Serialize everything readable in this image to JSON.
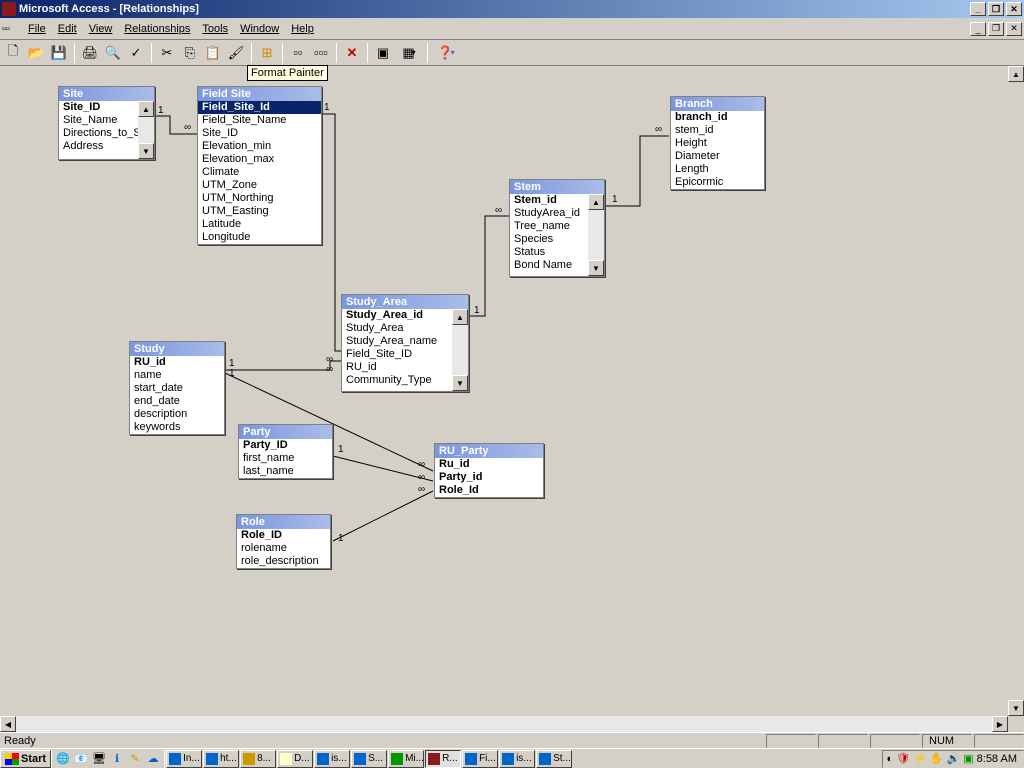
{
  "titlebar": {
    "title": "Microsoft Access - [Relationships]"
  },
  "menubar": {
    "file": "File",
    "edit": "Edit",
    "view": "View",
    "relationships": "Relationships",
    "tools": "Tools",
    "window": "Window",
    "help": "Help"
  },
  "tooltip": "Format Painter",
  "tables": {
    "site": {
      "title": "Site",
      "fields": [
        "Site_ID",
        "Site_Name",
        "Directions_to_Si",
        "Address"
      ]
    },
    "field_site": {
      "title": "Field Site",
      "fields": [
        "Field_Site_Id",
        "Field_Site_Name",
        "Site_ID",
        "Elevation_min",
        "Elevation_max",
        "Climate",
        "UTM_Zone",
        "UTM_Northing",
        "UTM_Easting",
        "Latitude",
        "Longitude"
      ]
    },
    "study_area": {
      "title": "Study_Area",
      "fields": [
        "Study_Area_id",
        "Study_Area",
        "Study_Area_name",
        "Field_Site_ID",
        "RU_id",
        "Community_Type"
      ]
    },
    "stem": {
      "title": "Stem",
      "fields": [
        "Stem_id",
        "StudyArea_id",
        "Tree_name",
        "Species",
        "Status",
        "Bond Name"
      ]
    },
    "branch": {
      "title": "Branch",
      "fields": [
        "branch_id",
        "stem_id",
        "Height",
        "Diameter",
        "Length",
        "Epicormic"
      ]
    },
    "study": {
      "title": "Study",
      "fields": [
        "RU_id",
        "name",
        "start_date",
        "end_date",
        "description",
        "keywords"
      ]
    },
    "party": {
      "title": "Party",
      "fields": [
        "Party_ID",
        "first_name",
        "last_name"
      ]
    },
    "role": {
      "title": "Role",
      "fields": [
        "Role_ID",
        "rolename",
        "role_description"
      ]
    },
    "ru_party": {
      "title": "RU_Party",
      "fields": [
        "Ru_id",
        "Party_id",
        "Role_Id"
      ]
    }
  },
  "cardinality": {
    "one": "1",
    "many": "∞"
  },
  "statusbar": {
    "ready": "Ready",
    "num": "NUM"
  },
  "taskbar": {
    "start": "Start",
    "tasks": [
      "In...",
      "ht...",
      "8...",
      "D...",
      "is...",
      "S...",
      "Mi...",
      "R...",
      "Fi...",
      "is...",
      "St..."
    ],
    "clock": "8:58 AM"
  }
}
